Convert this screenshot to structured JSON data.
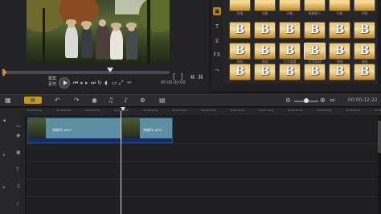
{
  "preview": {
    "labels": [
      "專案",
      "素材"
    ],
    "timecode": "00:00:00:00",
    "mark_in": "[",
    "mark_out": "]"
  },
  "library": {
    "sidebar": [
      "media-icon",
      "title-icon",
      "transition-icon",
      "fx-icon",
      "path-icon"
    ],
    "tiles": [
      {
        "label": "逐漸",
        "glyph": ""
      },
      {
        "label": "功能",
        "glyph": ""
      },
      {
        "label": "功能",
        "glyph": ""
      },
      {
        "label": "漸層跑入",
        "glyph": ""
      },
      {
        "label": "功能",
        "glyph": ""
      },
      {
        "label": "功能",
        "glyph": ""
      },
      {
        "label": "",
        "glyph": "B"
      },
      {
        "label": "",
        "glyph": "B"
      },
      {
        "label": "",
        "glyph": "B"
      },
      {
        "label": "",
        "glyph": "B"
      },
      {
        "label": "",
        "glyph": "B"
      },
      {
        "label": "",
        "glyph": "B"
      },
      {
        "label": "飛翔",
        "glyph": "B"
      },
      {
        "label": "飛翔",
        "glyph": "B"
      },
      {
        "label": "文字漸層",
        "glyph": "B"
      },
      {
        "label": "文字延伸",
        "glyph": "B"
      },
      {
        "label": "飛翔",
        "glyph": "B"
      },
      {
        "label": "飛翔",
        "glyph": "B"
      },
      {
        "label": "",
        "glyph": "B"
      },
      {
        "label": "",
        "glyph": "B"
      },
      {
        "label": "",
        "glyph": "B"
      },
      {
        "label": "",
        "glyph": "B"
      },
      {
        "label": "",
        "glyph": "B"
      },
      {
        "label": "",
        "glyph": "B"
      }
    ]
  },
  "toolbar": {
    "storyboard": "▦",
    "timeline": "▤",
    "timecode": "00:00:12:22"
  },
  "ruler": [
    "00:00:00:00",
    "00:00:02:00",
    "00:00:04:00",
    "00:00:06:00",
    "00:00:08:00",
    "00:00:10:00",
    "00:00:12:00",
    "00:00:14:00",
    "00:00:16:00",
    "00:00:18:00",
    "00:00:20:00",
    "00:00:22:00",
    "00:00:24:00"
  ],
  "clips": [
    {
      "name": "賞楓01.wmv"
    },
    {
      "name": "賞楓02.wmv"
    }
  ]
}
